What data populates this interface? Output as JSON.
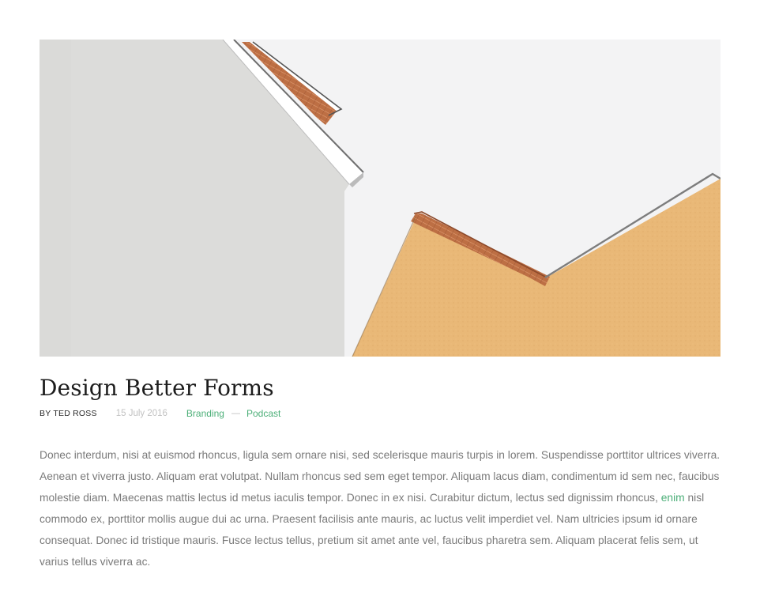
{
  "hero_image": {
    "alt": "",
    "colors": {
      "sky": "#f3f3f4",
      "left_wall": "#dcdcda",
      "right_wall": "#e9b877",
      "roof_tiles": "#bd6f44",
      "trim": "#ffffff",
      "edge": "#7d7d7d"
    }
  },
  "post": {
    "title": "Design Better Forms",
    "author_prefix": "By",
    "author": "Ted Ross",
    "date": "15 July 2016",
    "categories": [
      "Branding",
      "Podcast"
    ],
    "category_separator": "—",
    "body_before_link": "Donec interdum, nisi at euismod rhoncus, ligula sem ornare nisi, sed scelerisque mauris turpis in lorem. Suspendisse porttitor ultrices viverra. Aenean et viverra justo. Aliquam erat volutpat. Nullam rhoncus sed sem eget tempor. Aliquam lacus diam, condimentum id sem nec, faucibus molestie diam. Maecenas mattis lectus id metus iaculis tempor. Donec in ex nisi. Curabitur dictum, lectus sed dignissim rhoncus, ",
    "body_link": "enim",
    "body_after_link": " nisl commodo ex, porttitor mollis augue dui ac urna. Praesent facilisis ante mauris, ac luctus velit imperdiet vel. Nam ultricies ipsum id ornare consequat. Donec id tristique mauris. Fusce lectus tellus, pretium sit amet ante vel, faucibus pharetra sem. Aliquam placerat felis sem, ut varius tellus viverra ac."
  },
  "theme": {
    "accent": "#4caf78",
    "text": "#7a7a7a",
    "heading": "#1c1c1c",
    "muted": "#c2c2c2"
  }
}
